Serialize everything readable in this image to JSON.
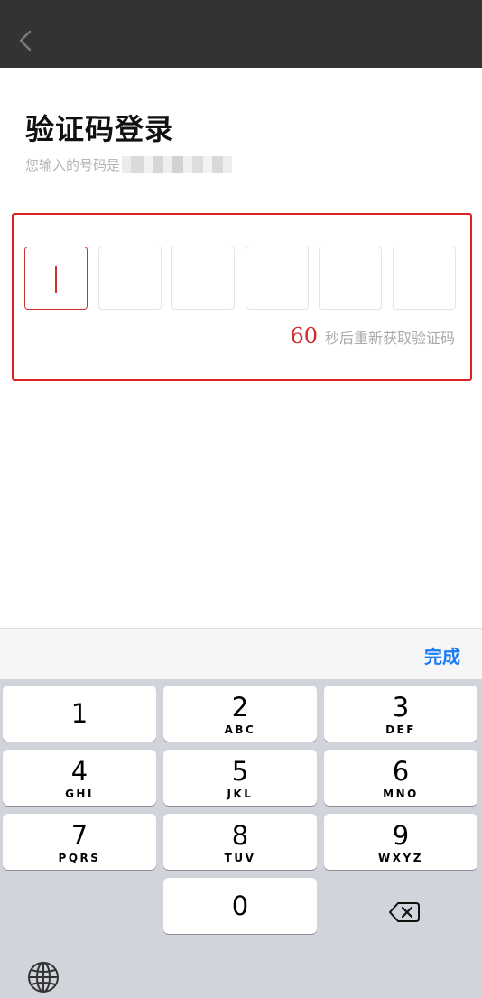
{
  "navbar": {
    "back_icon": "chevron-left-icon",
    "background": "#333333"
  },
  "page": {
    "title": "验证码登录",
    "subtitle": "您输入的号码是"
  },
  "code_input": {
    "length": 6,
    "active_index": 0,
    "values": [
      "",
      "",
      "",
      "",
      "",
      ""
    ],
    "accent_color": "#d43030"
  },
  "resend": {
    "countdown": "60",
    "text": "秒后重新获取验证码"
  },
  "keyboard": {
    "toolbar_done": "完成",
    "done_color": "#1a7cf5",
    "keys": [
      {
        "digit": "1",
        "letters": ""
      },
      {
        "digit": "2",
        "letters": "ABC"
      },
      {
        "digit": "3",
        "letters": "DEF"
      },
      {
        "digit": "4",
        "letters": "GHI"
      },
      {
        "digit": "5",
        "letters": "JKL"
      },
      {
        "digit": "6",
        "letters": "MNO"
      },
      {
        "digit": "7",
        "letters": "PQRS"
      },
      {
        "digit": "8",
        "letters": "TUV"
      },
      {
        "digit": "9",
        "letters": "WXYZ"
      },
      {
        "digit": "0",
        "letters": ""
      }
    ],
    "delete_icon": "backspace-icon",
    "globe_icon": "globe-icon"
  },
  "highlight_color": "#e02020"
}
